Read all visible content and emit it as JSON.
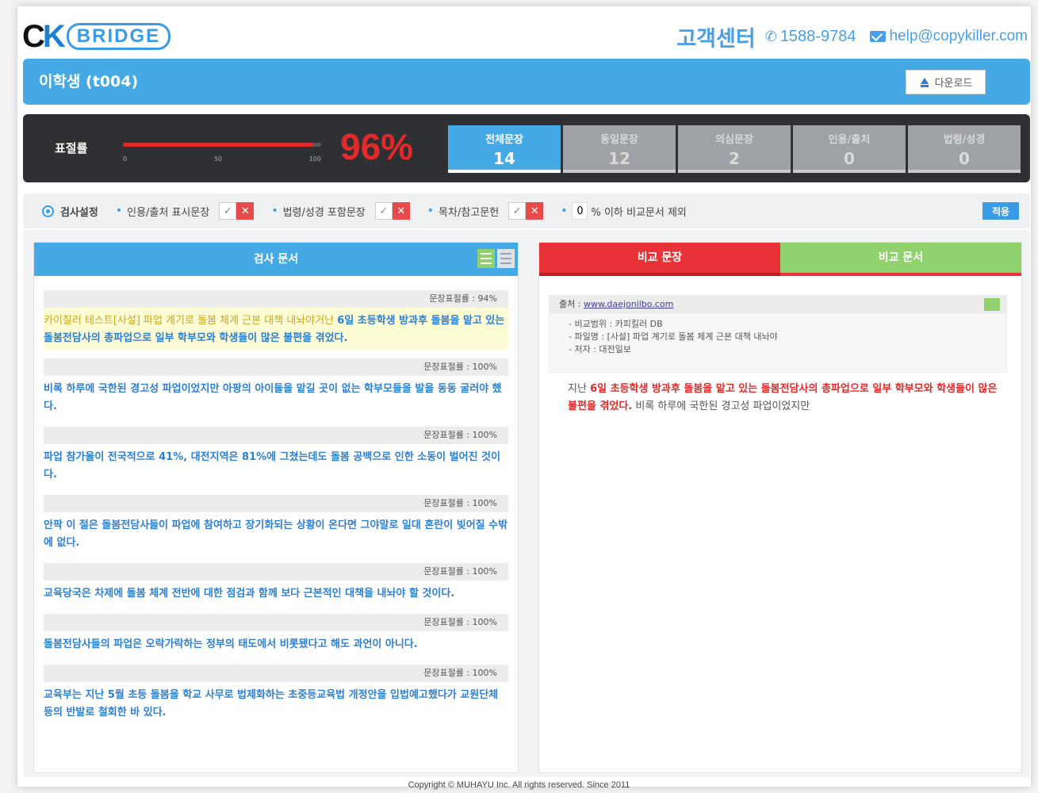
{
  "brand": {
    "logo_mark": "CK",
    "logo_text": "BRIDGE"
  },
  "customer_center": {
    "title": "고객센터",
    "phone": "1588-9784",
    "email": "help@copykiller.com",
    "phone_icon": "phone-icon",
    "mail_icon": "mail-icon"
  },
  "user": {
    "name": "이학생 (t004)"
  },
  "download_button": {
    "label": "다운로드",
    "icon": "download-icon"
  },
  "score": {
    "label": "표절률",
    "value": "96%",
    "level": 0.96,
    "slider_ticks": [
      "0",
      "50",
      "100"
    ]
  },
  "tabs": [
    {
      "label": "전체문장",
      "count": "14",
      "active": true
    },
    {
      "label": "동일문장",
      "count": "12",
      "active": false
    },
    {
      "label": "의심문장",
      "count": "2",
      "active": false
    },
    {
      "label": "인용/출처",
      "count": "0",
      "active": false
    },
    {
      "label": "법령/성경",
      "count": "0",
      "active": false
    }
  ],
  "settings": {
    "title": "검사설정",
    "options": [
      {
        "label": "인용/출처 표시문장"
      },
      {
        "label": "법령/성경 포함문장"
      },
      {
        "label": "목차/참고문헌"
      }
    ],
    "exclude_prefix": "0",
    "exclude_label": "% 이하 비교문서 제외",
    "apply_label": "적용"
  },
  "left_panel": {
    "title": "검사 문서",
    "sentences": [
      {
        "header": "문장표절률 : 94%",
        "plain": "카이칠러 테스트[사설] 파업 계기로 돌봄 체계 근본 대책 내놔야거난 ",
        "text": "6일 초등학생 방과후 돌봄을 맡고 있는 돌봄전담사의 총파업으로 일부 학부모와 학생들이 많은 불편을 겪었다.",
        "highlight": true
      },
      {
        "header": "문장표절률 : 100%",
        "plain": "",
        "text": "비록 하루에 국한된 경고성 파업이었지만 아팡의 아이들을 맡길 곳이 없는 학부모들을 발을 동동 굴러야 했다.",
        "highlight": false
      },
      {
        "header": "문장표절률 : 100%",
        "plain": "",
        "text": "파업 참가율이 전국적으로 41%, 대전지역은 81%에 그쳤는데도 돌봄 공백으로 인한 소동이 벌어진 것이다.",
        "highlight": false
      },
      {
        "header": "문장표절률 : 100%",
        "plain": "",
        "text": "안팍 이 절은 돌봄전담사들이 파업에 참여하고 장기화되는 상황이 온다면 그야말로 일대 혼란이 빚어질 수밖에 없다.",
        "highlight": false
      },
      {
        "header": "문장표절률 : 100%",
        "plain": "",
        "text": "교육당국은 차제에 돌봄 체계 전반에 대한 점검과 함께 보다 근본적인 대책을 내놔야 할 것이다.",
        "highlight": false
      },
      {
        "header": "문장표절률 : 100%",
        "plain": "",
        "text": "돌봄전담사들의 파업은 오락가락하는 정부의 태도에서 비롯됐다고 해도 과언이 아니다.",
        "highlight": false
      },
      {
        "header": "문장표절률 : 100%",
        "plain": "",
        "text": "교육부는 지난 5월 초등 돌봄을 학교 사무로 법제화하는 초중등교육법 개정안을 입법예고했다가 교원단체 등의 반발로 철회한 바 있다.",
        "highlight": false
      }
    ]
  },
  "right_panel": {
    "tab_sentence": "비교 문장",
    "tab_document": "비교 문서",
    "source": {
      "prefix": "출처 :",
      "url": "www.daejonilbo.com",
      "meta": [
        "- 비교범위 : 카피킬러 DB",
        "- 파일명 : [사설] 파업 계기로 돌봄 체계 근본 대책 내놔야",
        "- 저자 : 대전일보"
      ]
    },
    "match_pre": "지난 ",
    "match_hit": "6일 초등학생 방과후 돌봄을 맡고 있는 돌봄전담사의 총파업으로 일부 학부모와 학생들이 많은 불편을 겪었다.",
    "match_post": " 비록 하루에 국한된 경고성 파업이었지만"
  },
  "footer": {
    "text": "Copyright © MUHAYU Inc. All rights reserved. Since 2011"
  },
  "colors": {
    "accent_blue": "#45a9e6",
    "score_red": "#e22a2a",
    "dark_bar": "#2e3034",
    "green": "#8fd16d"
  }
}
